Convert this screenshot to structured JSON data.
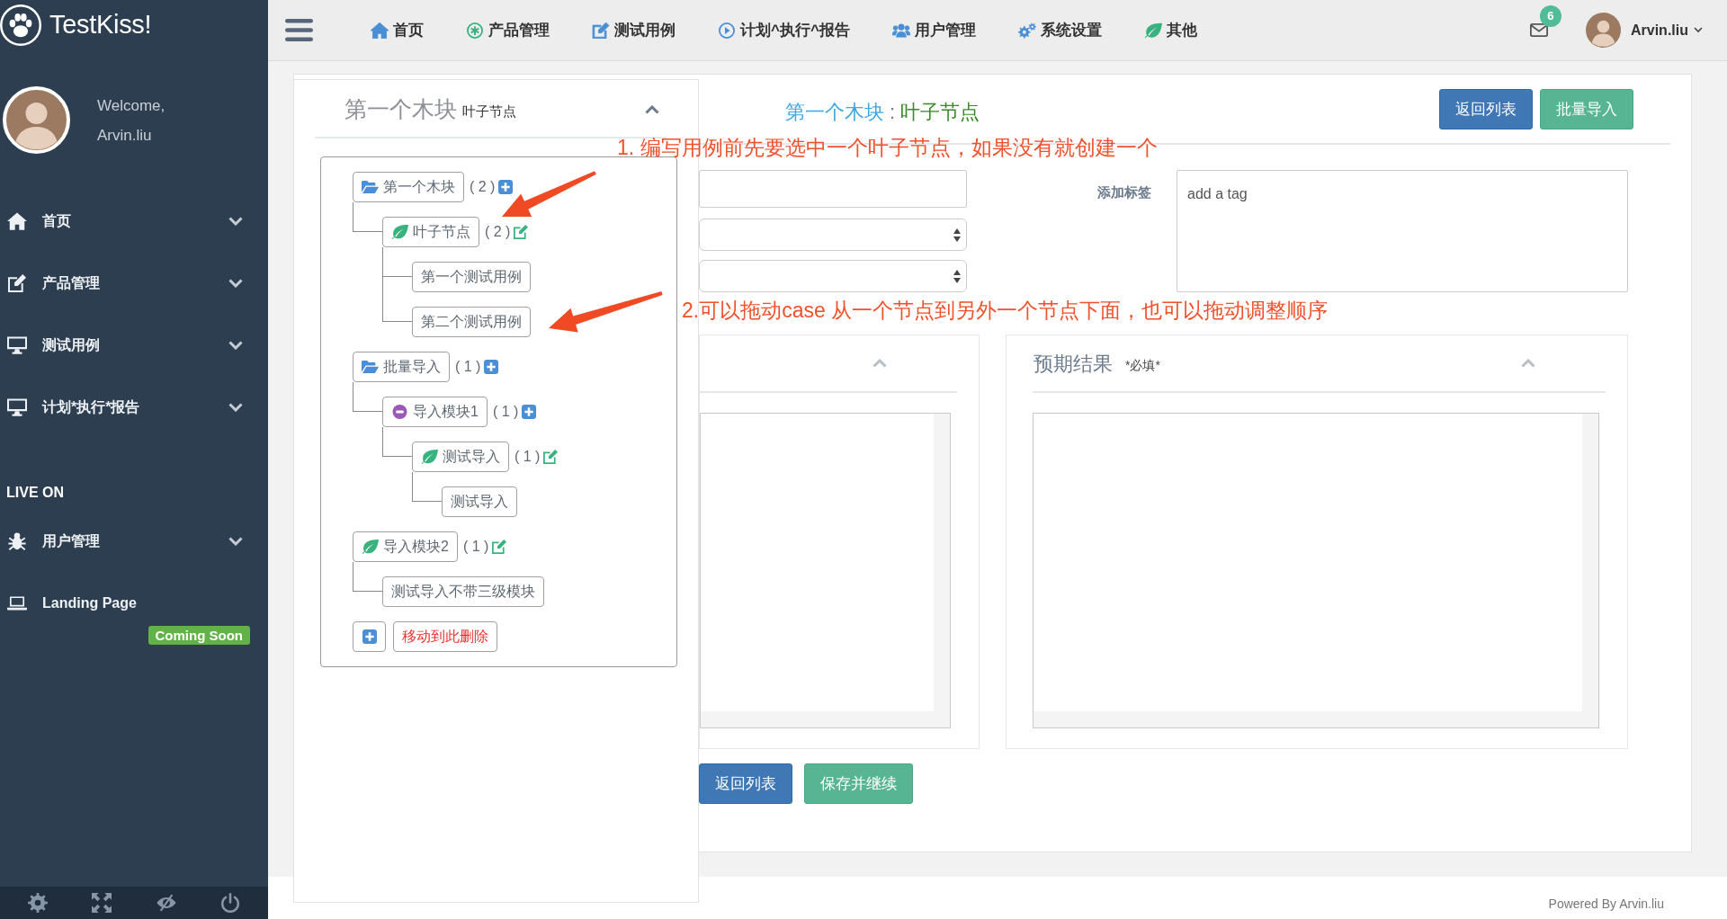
{
  "sidebar": {
    "brand": "TestKiss!",
    "welcome": "Welcome,",
    "user": "Arvin.liu",
    "menu": [
      {
        "label": "首页",
        "expanded": false
      },
      {
        "label": "产品管理",
        "expanded": false
      },
      {
        "label": "测试用例",
        "expanded": false
      },
      {
        "label": "计划*执行*报告",
        "expanded": false
      }
    ],
    "section": {
      "title": "LIVE ON",
      "items": [
        {
          "label": "用户管理",
          "expanded": false
        },
        {
          "label": "Landing Page",
          "badge": "Coming Soon"
        }
      ]
    }
  },
  "topbar": {
    "nav": [
      {
        "label": "首页"
      },
      {
        "label": "产品管理"
      },
      {
        "label": "测试用例"
      },
      {
        "label": "计划^执行^报告"
      },
      {
        "label": "用户管理"
      },
      {
        "label": "系统设置"
      },
      {
        "label": "其他"
      }
    ],
    "messages": "6",
    "user": "Arvin.liu"
  },
  "tree_panel": {
    "title": "第一个木块",
    "subtitle": "叶子节点",
    "expanded": true,
    "tree": [
      {
        "label": "第一个木块",
        "kind": "folder",
        "count": "( 2 )",
        "children": [
          {
            "label": "叶子节点",
            "kind": "leaf",
            "count": "( 2 )",
            "children": [
              {
                "label": "第一个测试用例",
                "kind": "case"
              },
              {
                "label": "第二个测试用例",
                "kind": "case"
              }
            ]
          }
        ]
      },
      {
        "label": "批量导入",
        "kind": "folder",
        "count": "( 1 )",
        "children": [
          {
            "label": "导入模块1",
            "kind": "module",
            "count": "( 1 )",
            "children": [
              {
                "label": "测试导入",
                "kind": "leaf",
                "count": "( 1 )",
                "children": [
                  {
                    "label": "测试导入",
                    "kind": "case"
                  }
                ]
              }
            ]
          }
        ]
      },
      {
        "label": "导入模块2",
        "kind": "leaf",
        "count": "( 1 )",
        "children": [
          {
            "label": "测试导入不带三级模块",
            "kind": "case"
          }
        ]
      }
    ],
    "actions": [
      {
        "kind": "add"
      },
      {
        "kind": "delete",
        "label": "移动到此删除"
      }
    ]
  },
  "card": {
    "heading": {
      "module": "第一个木块",
      "separator": ":",
      "leaf": "叶子节点"
    },
    "buttons": [
      {
        "label": "返回列表",
        "kind": "primary"
      },
      {
        "label": "批量导入",
        "kind": "success"
      }
    ],
    "fields": [
      {
        "kind": "text"
      },
      {
        "kind": "select"
      },
      {
        "kind": "select"
      }
    ],
    "tags": {
      "label": "添加标签",
      "placeholder": "add a tag"
    },
    "panels": [
      {
        "expanded": true
      },
      {
        "title": "预期结果",
        "note": "*必填*",
        "expanded": true
      }
    ],
    "actions": [
      {
        "label": "返回列表",
        "kind": "primary"
      },
      {
        "label": "保存并继续",
        "kind": "success"
      }
    ]
  },
  "annotations": [
    {
      "text": "1. 编写用例前先要选中一个叶子节点，如果没有就创建一个"
    },
    {
      "text": "2.可以拖动case 从一个节点到另外一个节点下面，也可以拖动调整顺序"
    }
  ],
  "footer": "Powered By Arvin.liu"
}
